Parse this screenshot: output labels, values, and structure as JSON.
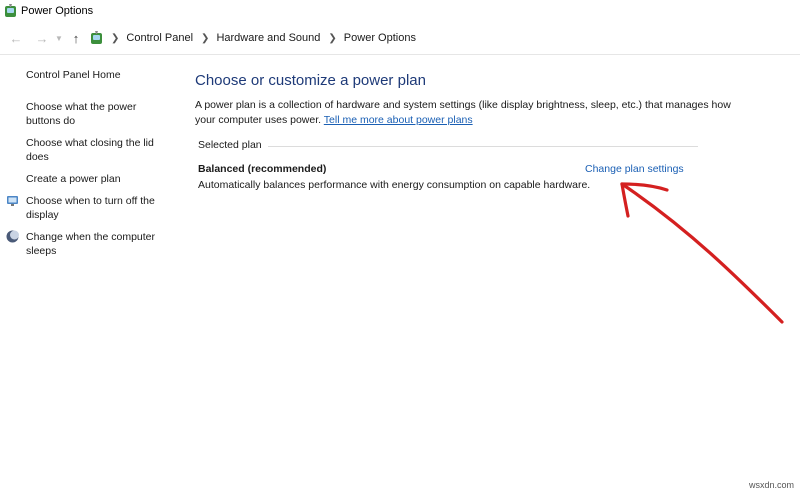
{
  "window": {
    "title": "Power Options"
  },
  "address_bar": {
    "breadcrumbs": [
      "Control Panel",
      "Hardware and Sound",
      "Power Options"
    ]
  },
  "sidebar": {
    "items": [
      {
        "label": "Control Panel Home"
      },
      {
        "label": "Choose what the power buttons do"
      },
      {
        "label": "Choose what closing the lid does"
      },
      {
        "label": "Create a power plan"
      },
      {
        "label": "Choose when to turn off the display"
      },
      {
        "label": "Change when the computer sleeps"
      }
    ]
  },
  "main": {
    "heading": "Choose or customize a power plan",
    "description": "A power plan is a collection of hardware and system settings (like display brightness, sleep, etc.) that manages how your computer uses power.",
    "learn_more_link": "Tell me more about power plans",
    "group_label": "Selected plan",
    "plan": {
      "name": "Balanced (recommended)",
      "description": "Automatically balances performance with energy consumption on capable hardware.",
      "settings_link": "Change plan settings"
    }
  },
  "annotation": {
    "arrow_color": "#d42020"
  },
  "watermark": "wsxdn.com"
}
